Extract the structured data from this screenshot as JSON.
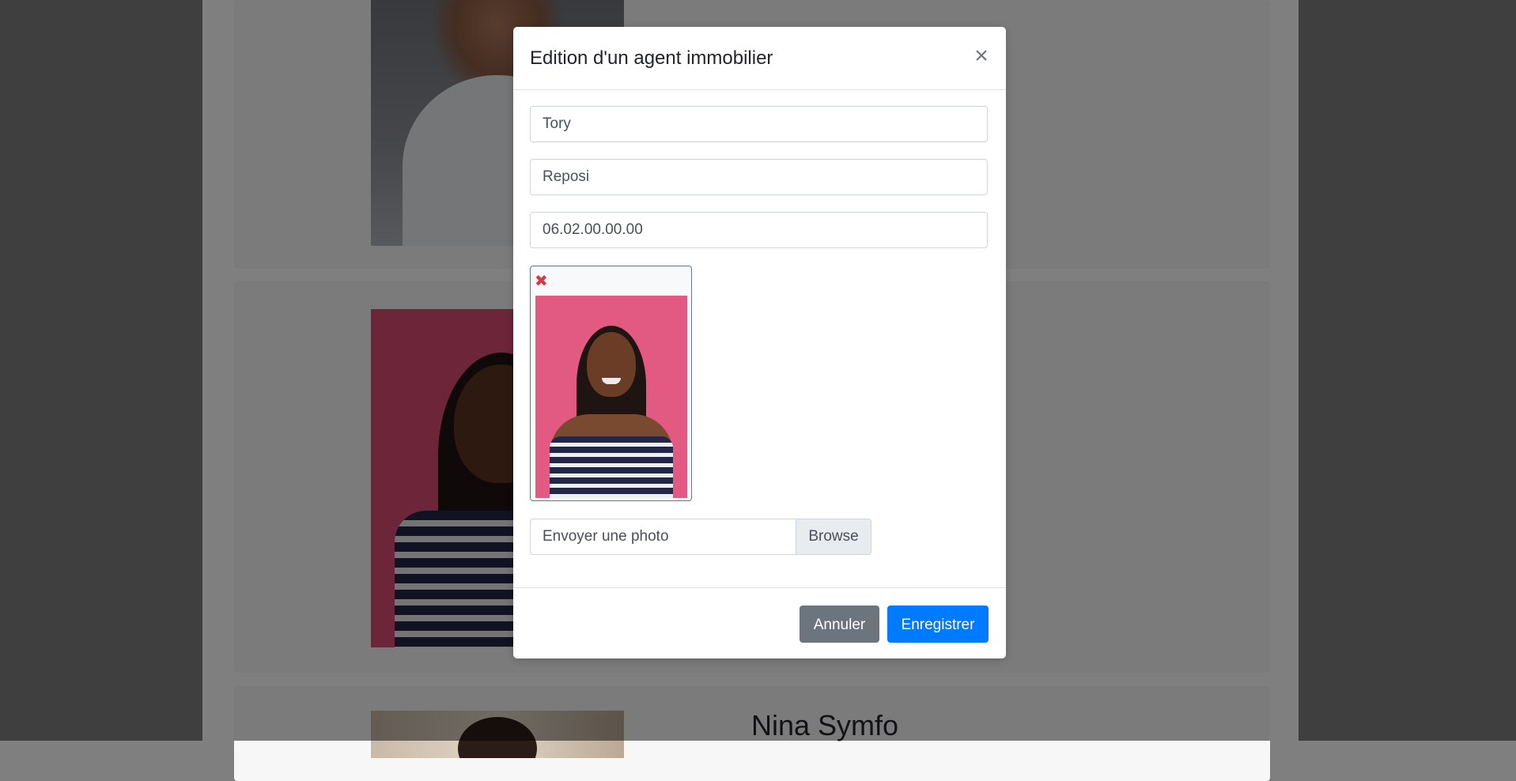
{
  "background": {
    "agents": [
      {
        "photo": "agent-photo-man"
      },
      {
        "photo": "agent-photo-woman"
      },
      {
        "photo": "agent-photo-nina",
        "name": "Nina Symfo"
      }
    ]
  },
  "modal": {
    "title": "Edition d'un agent immobilier",
    "close_symbol": "×",
    "fields": {
      "first_name": "Tory",
      "last_name": "Reposi",
      "phone": "06.02.00.00.00"
    },
    "photo_preview": {
      "remove_symbol": "✖",
      "icon": "remove-photo-icon"
    },
    "file_upload": {
      "label": "Envoyer une photo",
      "button": "Browse"
    },
    "buttons": {
      "cancel": "Annuler",
      "save": "Enregistrer"
    }
  },
  "colors": {
    "primary": "#007bff",
    "secondary": "#6c757d",
    "danger": "#dc3545",
    "backdrop": "#7f7f7f"
  }
}
